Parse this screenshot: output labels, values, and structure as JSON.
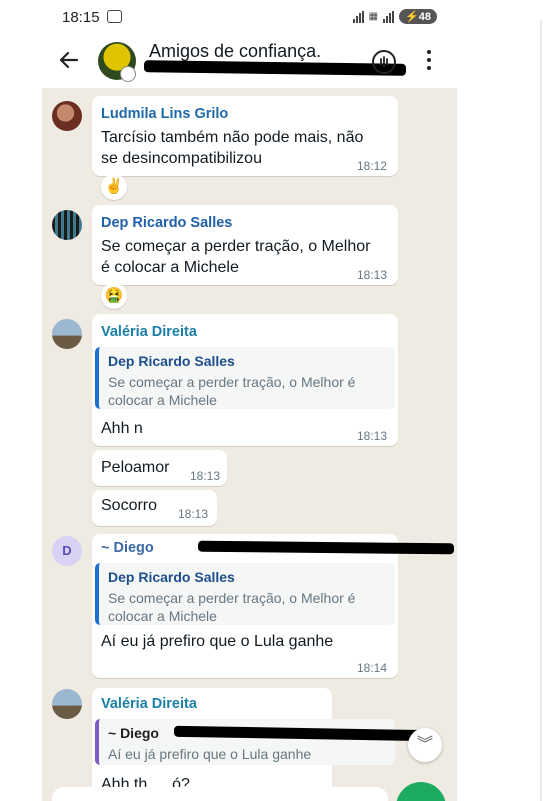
{
  "status_bar": {
    "time": "18:15",
    "battery": "48"
  },
  "header": {
    "title": "Amigos de confiança."
  },
  "messages": [
    {
      "sender": "Ludmila Lins Grilo",
      "sender_color": "#1e6aa8",
      "text_line1": "Tarcísio também não pode mais, não",
      "text_line2": "se desincompatibilizou",
      "time": "18:12",
      "reaction": "✌️"
    },
    {
      "sender": "Dep Ricardo Salles",
      "sender_color": "#1e5fa8",
      "text_line1": "Se começar a perder tração, o Melhor",
      "text_line2": "é colocar a Michele",
      "time": "18:13",
      "reaction": "🤮"
    },
    {
      "sender": "Valéria Direita",
      "sender_color": "#1b7fa8",
      "quote_name": "Dep Ricardo Salles",
      "quote_line1": "Se começar a perder tração, o Melhor é",
      "quote_line2": "colocar a Michele",
      "text": "Ahh n",
      "time": "18:13"
    },
    {
      "text": "Peloamor",
      "time": "18:13"
    },
    {
      "text": "Socorro",
      "time": "18:13"
    },
    {
      "avatar_letter": "D",
      "sender": "~ Diego",
      "sender_color": "#3d6aa3",
      "quote_name": "Dep Ricardo Salles",
      "quote_line1": "Se começar a perder tração, o Melhor é",
      "quote_line2": "colocar a Michele",
      "text": "Aí eu já prefiro que o Lula ganhe",
      "time": "18:14"
    },
    {
      "sender": "Valéria Direita",
      "sender_color": "#1b7fa8",
      "quote_name": "~ Diego",
      "quote_text": "Aí eu já prefiro que o Lula ganhe",
      "partial_text": "Ahh th … ó?"
    }
  ],
  "icons": {
    "back": "arrow-left-icon",
    "voice_chat": "voice-chat-icon",
    "menu": "more-vert-icon",
    "scroll_down": "chevron-double-down-icon",
    "fab": "new-message-icon"
  },
  "colors": {
    "chat_background": "#efeae2",
    "bubble": "#ffffff",
    "accent_green": "#1daa61",
    "quote_bar_blue": "#1e6fd0",
    "quote_bar_purple": "#7c5cc4"
  }
}
